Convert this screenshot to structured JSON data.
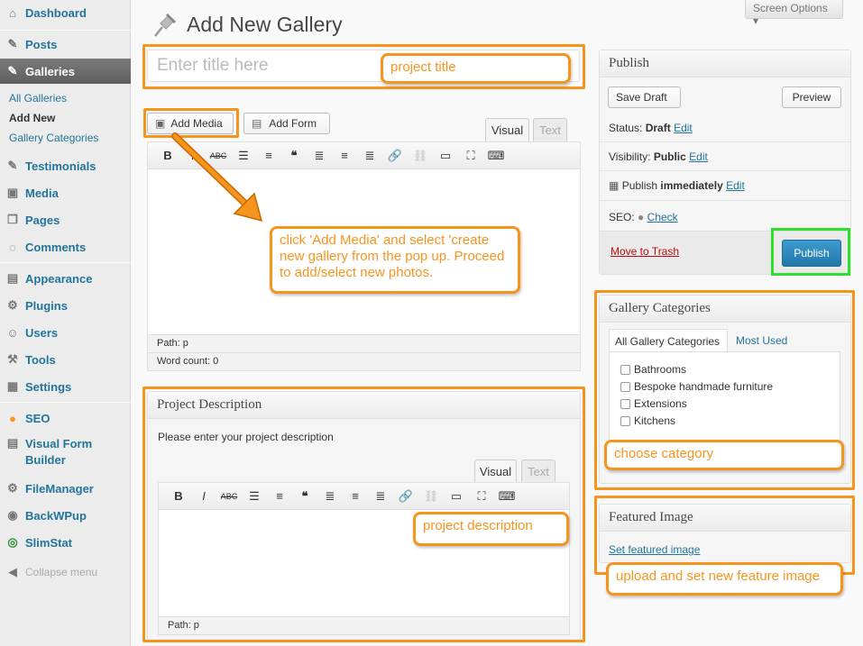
{
  "sidebar": {
    "items": [
      {
        "label": "Dashboard",
        "icon": "dashboard-icon",
        "glyph": "⌂"
      },
      {
        "label": "Posts",
        "icon": "pushpin-icon",
        "glyph": "✎"
      },
      {
        "label": "Galleries",
        "icon": "pushpin-icon",
        "glyph": "✎"
      },
      {
        "label": "Testimonials",
        "icon": "pushpin-icon",
        "glyph": "✎"
      },
      {
        "label": "Media",
        "icon": "media-icon",
        "glyph": "▣"
      },
      {
        "label": "Pages",
        "icon": "pages-icon",
        "glyph": "❐"
      },
      {
        "label": "Comments",
        "icon": "comment-icon",
        "glyph": "◌"
      },
      {
        "label": "Appearance",
        "icon": "appearance-icon",
        "glyph": "▤"
      },
      {
        "label": "Plugins",
        "icon": "plugin-icon",
        "glyph": "⚙"
      },
      {
        "label": "Users",
        "icon": "users-icon",
        "glyph": "☺"
      },
      {
        "label": "Tools",
        "icon": "tools-icon",
        "glyph": "⚒"
      },
      {
        "label": "Settings",
        "icon": "settings-icon",
        "glyph": "▦"
      },
      {
        "label": "SEO",
        "icon": "seo-icon",
        "glyph": "●"
      },
      {
        "label": "Visual Form Builder",
        "icon": "form-icon",
        "glyph": "▤"
      },
      {
        "label": "FileManager",
        "icon": "gear-icon",
        "glyph": "⚙"
      },
      {
        "label": "BackWPup",
        "icon": "backup-icon",
        "glyph": "◉"
      },
      {
        "label": "SlimStat",
        "icon": "stats-icon",
        "glyph": "◎"
      },
      {
        "label": "Collapse menu",
        "icon": "collapse-icon",
        "glyph": "◀"
      }
    ],
    "submenu": [
      "All Galleries",
      "Add New",
      "Gallery Categories"
    ]
  },
  "header": {
    "title": "Add New Gallery",
    "screen_options": "Screen Options ▾"
  },
  "title_field": {
    "placeholder": "Enter title here"
  },
  "editor": {
    "add_media": "Add Media",
    "add_form": "Add Form",
    "tab_visual": "Visual",
    "tab_text": "Text",
    "path": "Path: p",
    "word_count": "Word count: 0"
  },
  "toolbar_buttons": [
    "B",
    "I",
    "ABC",
    "☰",
    "≡",
    "❝",
    "≣",
    "≡",
    "≣",
    "🔗",
    "⛓",
    "▭",
    "⛶",
    "⌨"
  ],
  "project_description": {
    "heading": "Project Description",
    "prompt": "Please enter your project description",
    "tab_visual": "Visual",
    "tab_text": "Text",
    "path": "Path: p"
  },
  "publish": {
    "heading": "Publish",
    "save_draft": "Save Draft",
    "preview": "Preview",
    "status_label": "Status:",
    "status_value": "Draft",
    "visibility_label": "Visibility:",
    "visibility_value": "Public",
    "publish_label": "Publish",
    "publish_value": "immediately",
    "seo_label": "SEO:",
    "seo_check": "Check",
    "edit": "Edit",
    "trash": "Move to Trash",
    "publish_button": "Publish"
  },
  "gallery_categories": {
    "heading": "Gallery Categories",
    "tab_all": "All Gallery Categories",
    "tab_most": "Most Used",
    "items": [
      "Bathrooms",
      "Bespoke handmade furniture",
      "Extensions",
      "Kitchens"
    ]
  },
  "featured_image": {
    "heading": "Featured Image",
    "link": "Set featured image"
  },
  "annotations": {
    "project_title": "project title",
    "add_media_note": "click 'Add Media' and select 'create new gallery from the pop up. Proceed to add/select new photos.",
    "project_description": "project description",
    "choose_category": "choose category",
    "feature_image": "upload and set new feature image"
  },
  "colors": {
    "annotation": "#f7941d",
    "publish_highlight": "#2ee02e",
    "publish_button": "#2e8bbd",
    "link": "#21759b"
  }
}
